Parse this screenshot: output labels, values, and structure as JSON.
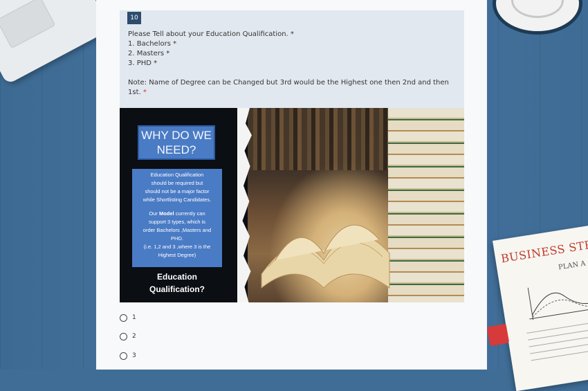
{
  "question": {
    "number": "10",
    "lines": [
      "Please Tell about your Education Qualification. *",
      "1. Bachelors *",
      "2. Masters *",
      "3. PHD *"
    ],
    "note": "Note: Name of Degree can be Changed but 3rd would be the Highest one then 2nd and then 1st.",
    "note_required": "*"
  },
  "banner": {
    "heading_line1": "WHY DO WE",
    "heading_line2": "NEED?",
    "info_lines_a": [
      "Education Qualification",
      "should be required but",
      "should not be a major factor",
      "while Shortlisting Candidates."
    ],
    "info_lines_b_prefix": "Our",
    "info_lines_b_bold": "Model",
    "info_lines_b_rest": "currently can",
    "info_lines_b": [
      "support 3 types, which is",
      "order Bachelors ,Masters and",
      "PHD.",
      "(i.e. 1,2 and 3 ,where 3 is the",
      "Highest Degree)"
    ],
    "footer_line1": "Education",
    "footer_line2": "Qualification?"
  },
  "options": [
    "1",
    "2",
    "3"
  ],
  "decor": {
    "notebook_title": "BUSINESS STRATEGY",
    "notebook_subtitle": "PLAN A"
  },
  "colors": {
    "question_bg": "#e2e8ef",
    "number_badge": "#2e4d6e",
    "required": "#c0392b",
    "banner_box": "#4a7bc5"
  }
}
